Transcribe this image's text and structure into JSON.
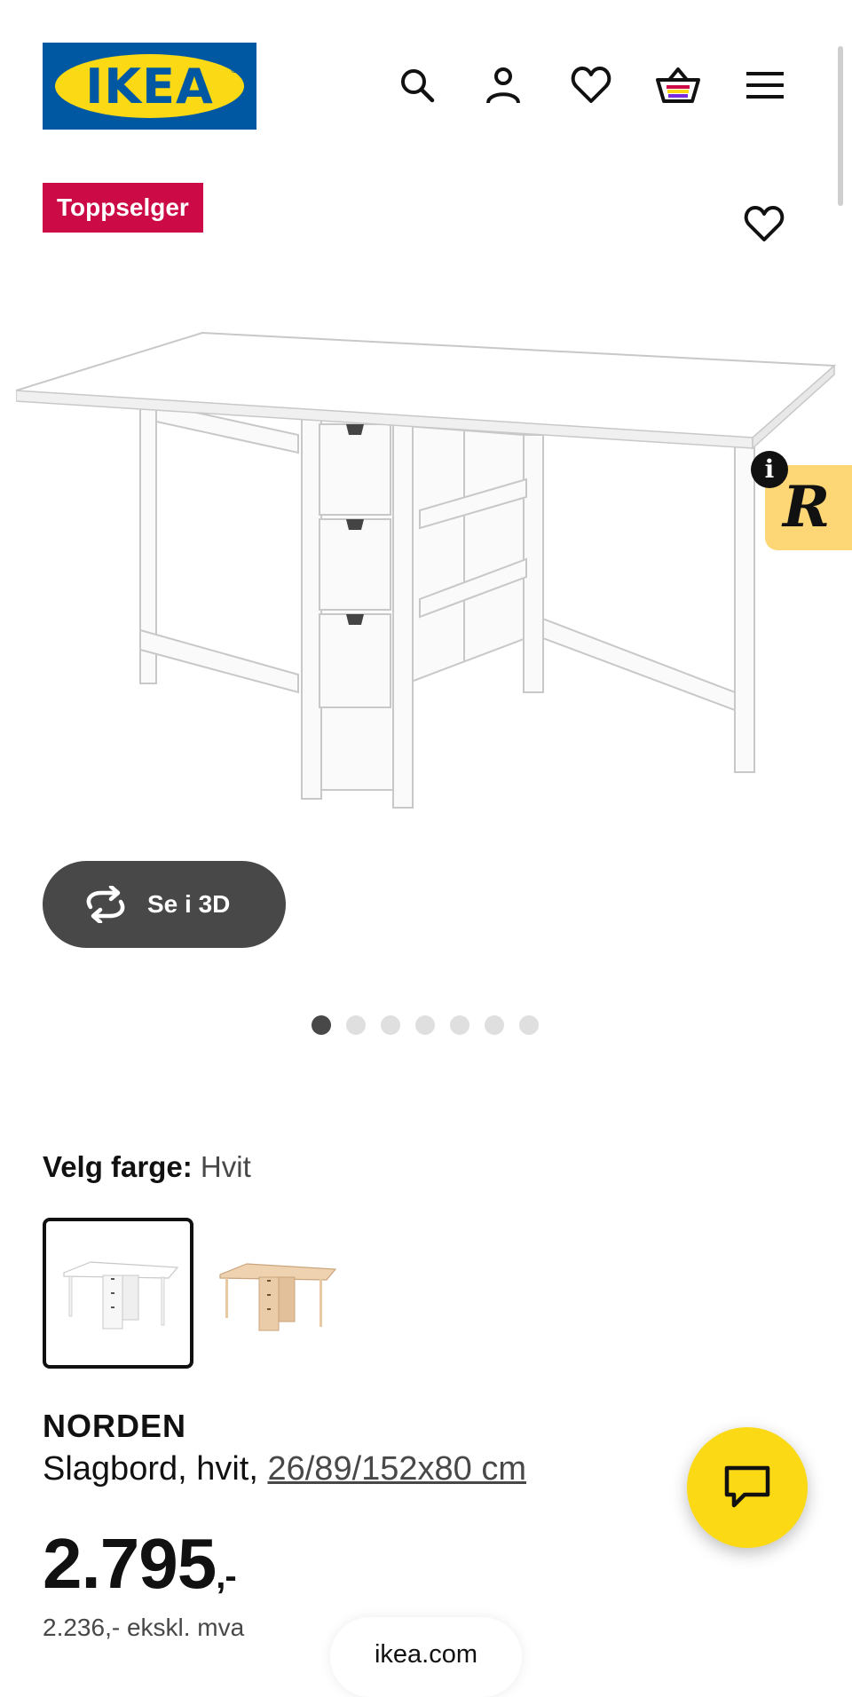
{
  "header": {
    "logo_text": "IKEA",
    "logo_registered": "®",
    "icons": [
      "search-icon",
      "account-icon",
      "heart-icon",
      "cart-icon",
      "menu-icon"
    ]
  },
  "badge": "Toppselger",
  "view_3d": {
    "label": "Se i 3D",
    "icon": "rotate-3d-icon"
  },
  "carousel": {
    "count": 7,
    "active_index": 1
  },
  "recommendation_widget": {
    "letter": "R",
    "info": "i"
  },
  "color_select": {
    "label": "Velg farge:",
    "value": "Hvit",
    "options": [
      "Hvit",
      "Bjørk"
    ]
  },
  "product": {
    "name": "NORDEN",
    "description": "Slagbord, hvit, ",
    "size": "26/89/152x80 cm",
    "price_main": "2.795",
    "price_suffix": ",-",
    "price_ex_vat": "2.236,- ekskl. mva"
  },
  "browser": {
    "url": "ikea.com"
  },
  "colors": {
    "ikea_blue": "#0058A3",
    "ikea_yellow": "#FBD914",
    "badge_red": "#CC0A46",
    "button_dark": "#484848",
    "widget_yellow": "#FDD675"
  }
}
